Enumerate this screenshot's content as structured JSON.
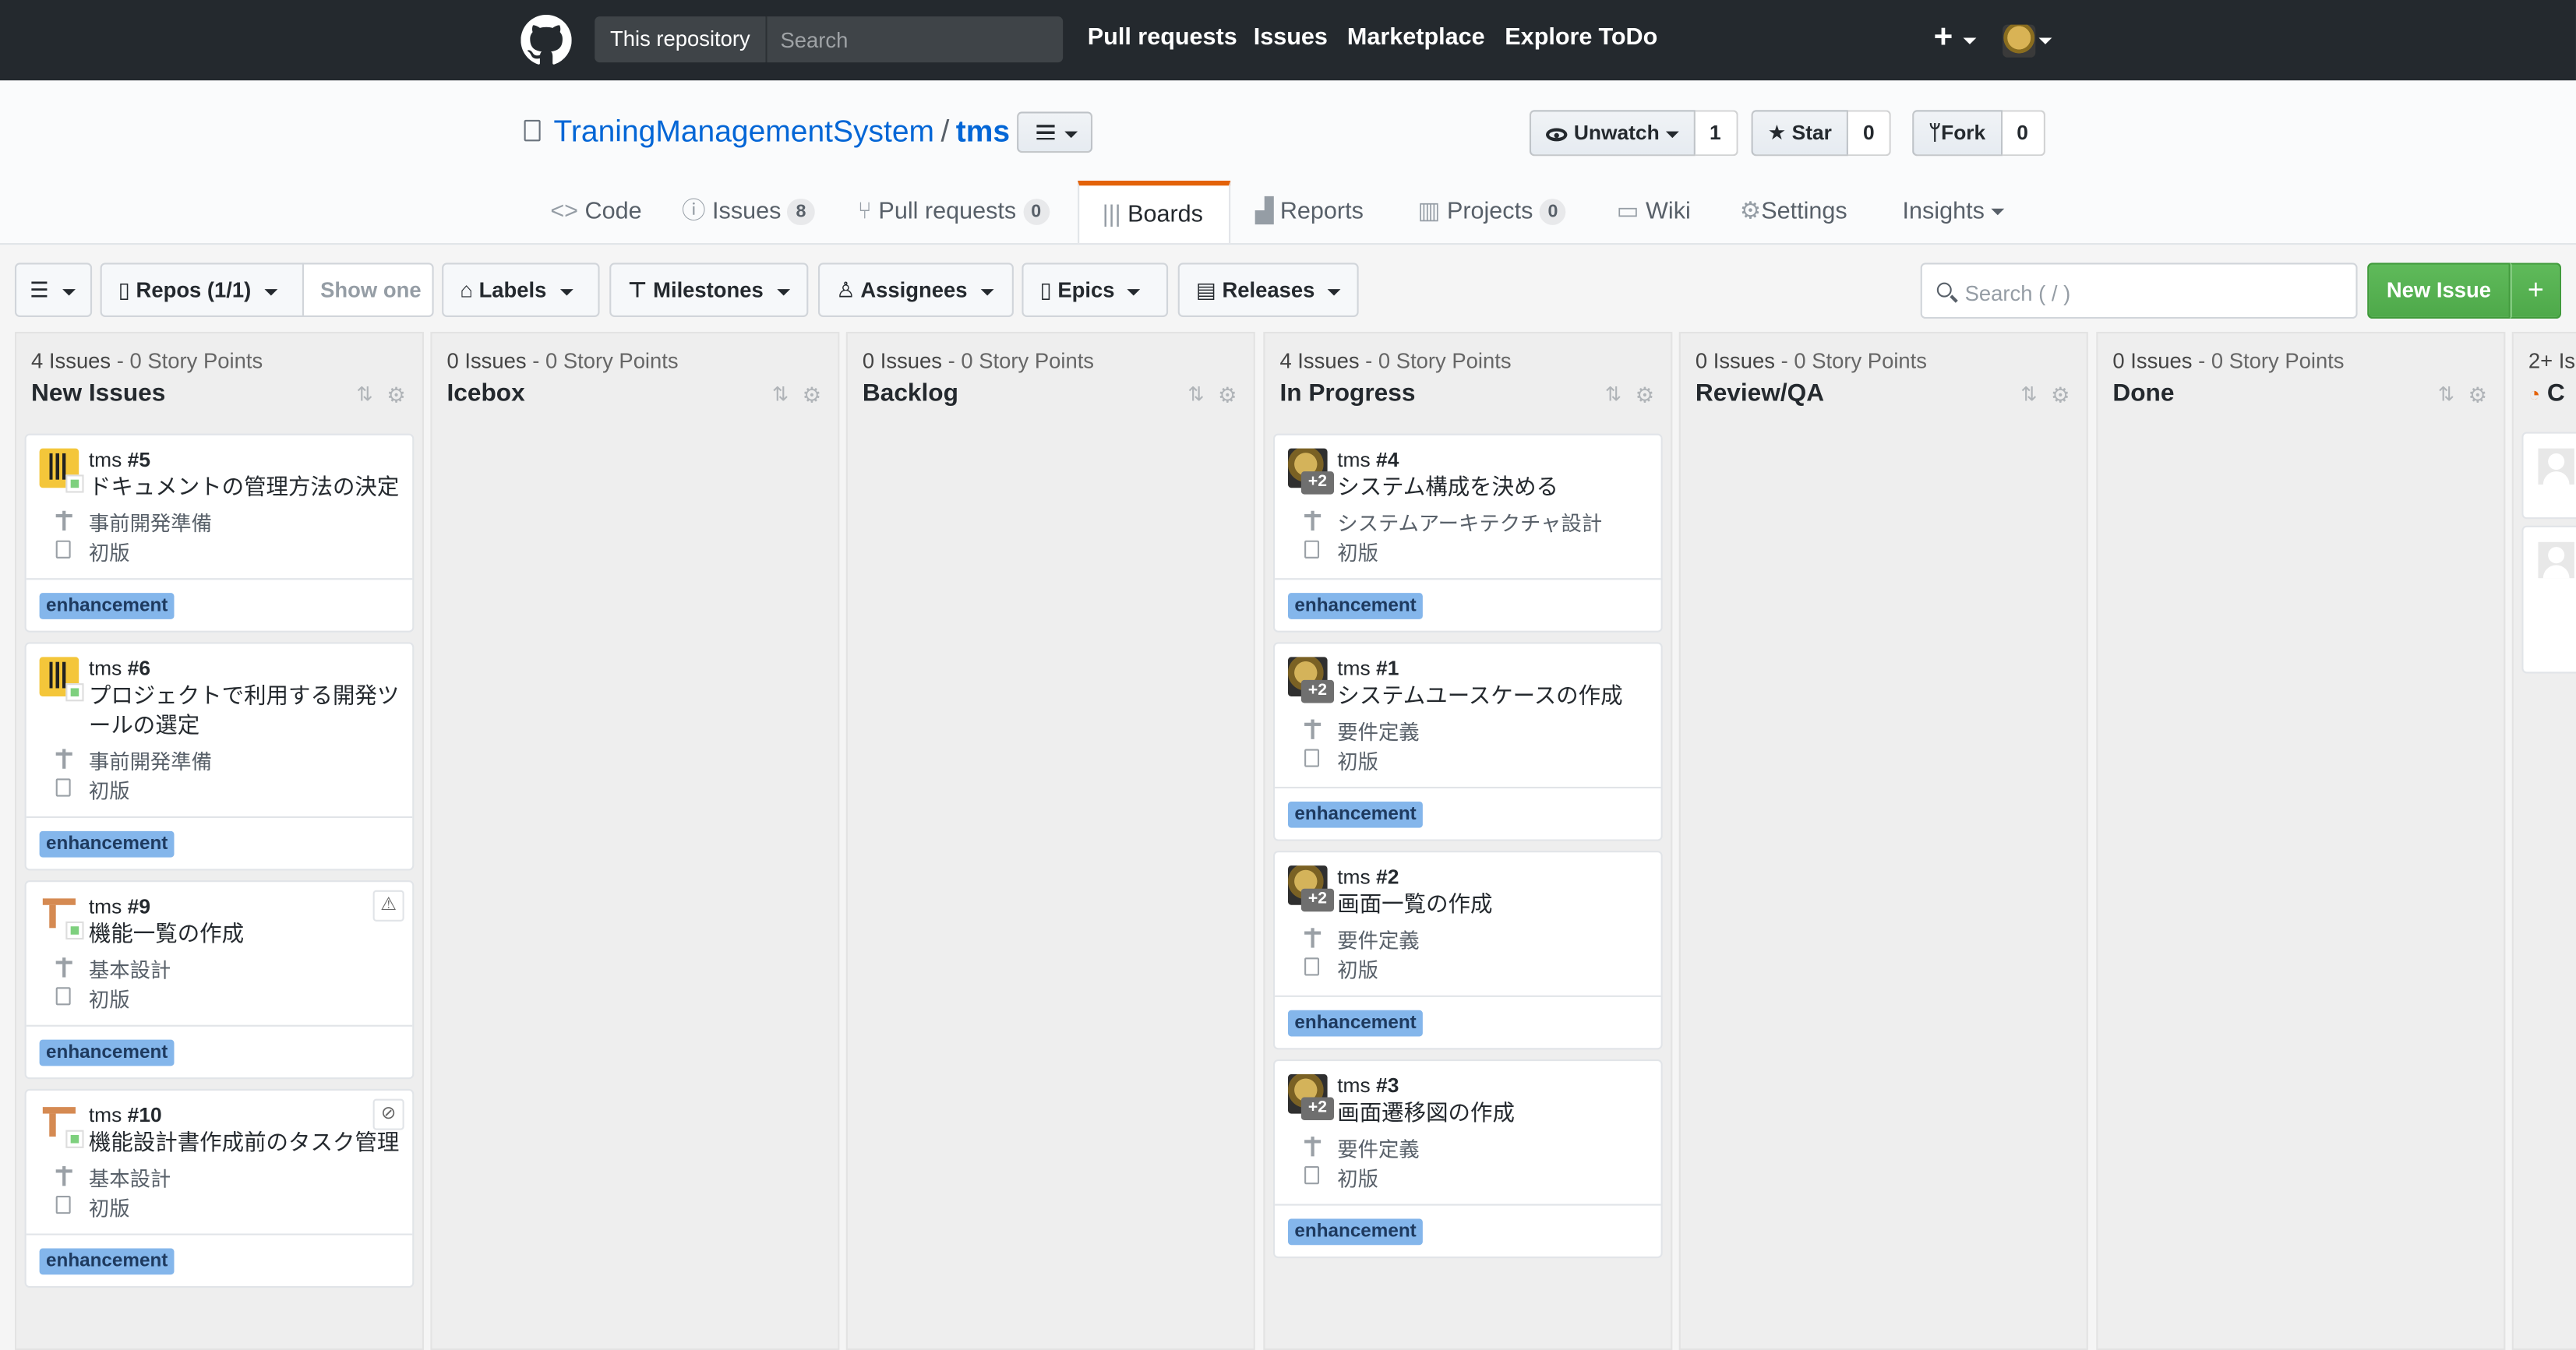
{
  "header": {
    "scope_label": "This repository",
    "search_placeholder": "Search",
    "nav": [
      "Pull requests",
      "Issues",
      "Marketplace",
      "Explore",
      "ToDo"
    ],
    "plus_glyph": "+"
  },
  "repo": {
    "owner": "TraningManagementSystem",
    "separator": "/",
    "name": "tms",
    "watch_label": "Unwatch",
    "watch_count": "1",
    "star_label": "Star",
    "star_count": "0",
    "fork_label": "Fork",
    "fork_count": "0"
  },
  "tabs": [
    {
      "label": "Code",
      "icon": "code-icon"
    },
    {
      "label": "Issues",
      "count": "8",
      "icon": "issue-icon"
    },
    {
      "label": "Pull requests",
      "count": "0",
      "icon": "pull-request-icon"
    },
    {
      "label": "Boards",
      "icon": "boards-icon",
      "selected": true
    },
    {
      "label": "Reports",
      "icon": "graph-icon"
    },
    {
      "label": "Projects",
      "count": "0",
      "icon": "project-icon"
    },
    {
      "label": "Wiki",
      "icon": "book-icon"
    },
    {
      "label": "Settings",
      "icon": "gear-icon"
    },
    {
      "label": "Insights",
      "icon": "chevron-down-icon"
    }
  ],
  "toolbar": {
    "repos_label": "Repos (1/1)",
    "show_one_label": "Show one",
    "labels_label": "Labels",
    "milestones_label": "Milestones",
    "assignees_label": "Assignees",
    "epics_label": "Epics",
    "releases_label": "Releases",
    "search_placeholder": "Search ( / )",
    "new_issue_label": "New Issue",
    "new_issue_plus": "+"
  },
  "columns": [
    {
      "title": "New Issues",
      "issues": "4 Issues",
      "points": "- 0 Story Points",
      "cards": [
        {
          "repo": "tms",
          "number": "#5",
          "title": "ドキュメントの管理方法の決定",
          "milestone": "事前開発準備",
          "epic": "初版",
          "label": "enhancement"
        },
        {
          "repo": "tms",
          "number": "#6",
          "title": "プロジェクトで利用する開発ツールの選定",
          "milestone": "事前開発準備",
          "epic": "初版",
          "label": "enhancement"
        },
        {
          "repo": "tms",
          "number": "#9",
          "title": "機能一覧の作成",
          "milestone": "基本設計",
          "epic": "初版",
          "label": "enhancement",
          "flag": "⚠"
        },
        {
          "repo": "tms",
          "number": "#10",
          "title": "機能設計書作成前のタスク管理",
          "milestone": "基本設計",
          "epic": "初版",
          "label": "enhancement",
          "flag": "⊘"
        }
      ]
    },
    {
      "title": "Icebox",
      "issues": "0 Issues",
      "points": "- 0 Story Points",
      "cards": []
    },
    {
      "title": "Backlog",
      "issues": "0 Issues",
      "points": "- 0 Story Points",
      "cards": []
    },
    {
      "title": "In Progress",
      "issues": "4 Issues",
      "points": "- 0 Story Points",
      "cards": [
        {
          "repo": "tms",
          "number": "#4",
          "title": "システム構成を決める",
          "milestone": "システムアーキテクチャ設計",
          "epic": "初版",
          "label": "enhancement",
          "assignees_more": "+2"
        },
        {
          "repo": "tms",
          "number": "#1",
          "title": "システムユースケースの作成",
          "milestone": "要件定義",
          "epic": "初版",
          "label": "enhancement",
          "assignees_more": "+2"
        },
        {
          "repo": "tms",
          "number": "#2",
          "title": "画面一覧の作成",
          "milestone": "要件定義",
          "epic": "初版",
          "label": "enhancement",
          "assignees_more": "+2"
        },
        {
          "repo": "tms",
          "number": "#3",
          "title": "画面遷移図の作成",
          "milestone": "要件定義",
          "epic": "初版",
          "label": "enhancement",
          "assignees_more": "+2"
        }
      ]
    },
    {
      "title": "Review/QA",
      "issues": "0 Issues",
      "points": "- 0 Story Points",
      "cards": []
    },
    {
      "title": "Done",
      "issues": "0 Issues",
      "points": "- 0 Story Points",
      "cards": []
    },
    {
      "title": "C",
      "issues": "2+ Is",
      "points": "",
      "cards": []
    }
  ],
  "colors": {
    "header_bg": "#24292e",
    "link_blue": "#0366d6",
    "selected_tab_accent": "#e36209",
    "new_issue_green": "#55b04f",
    "label_enhancement": "#84b6eb"
  }
}
